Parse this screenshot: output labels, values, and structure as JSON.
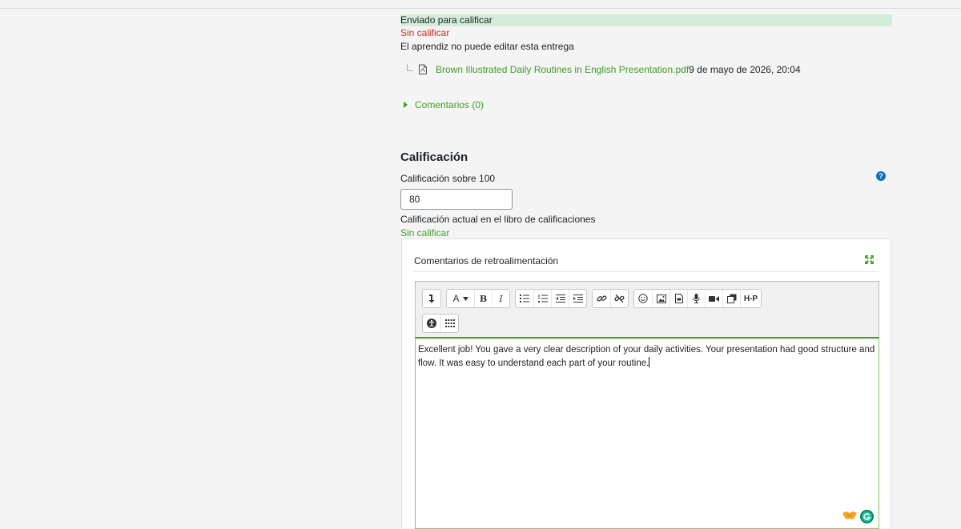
{
  "submission": {
    "status_submitted": "Enviado para calificar",
    "status_grading": "Sin calificar",
    "status_lock": "El aprendiz no puede editar esta entrega",
    "file": {
      "name": "Brown Illustrated Daily Routines in English Presentation.pdf",
      "date": "9 de mayo de 2026, 20:04"
    },
    "comments_label": "Comentarios (0)"
  },
  "grade": {
    "heading": "Calificación",
    "label": "Calificación sobre 100",
    "value": "80",
    "current_label": "Calificación actual en el libro de calificaciones",
    "current_value": "Sin calificar"
  },
  "feedback": {
    "title": "Comentarios de retroalimentación",
    "text": "Excellent job! You gave a very clear description of your daily activities. Your presentation had good structure and flow. It was easy to understand each part of your routine."
  },
  "toolbar": {
    "font_label": "A",
    "bold_label": "B",
    "italic_label": "I",
    "h5p_label": "H-P"
  },
  "icons": {
    "help": "question-circle-icon",
    "expand": "fullscreen-expand-icon",
    "file": "pdf-file-icon"
  },
  "colors": {
    "accent_green": "#3f9e26",
    "status_red": "#ca3120",
    "submitted_bg": "#d4edda",
    "help_blue": "#0f6cbf"
  }
}
